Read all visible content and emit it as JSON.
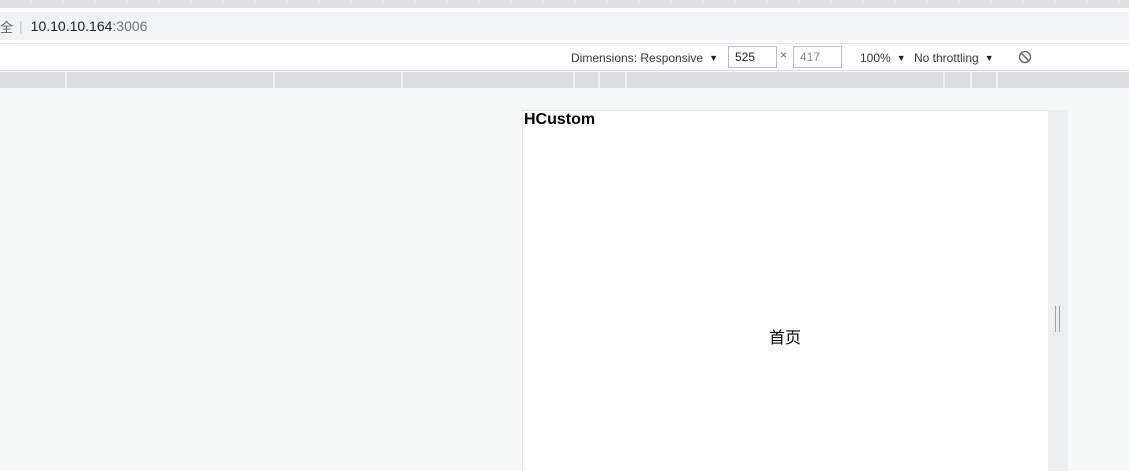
{
  "browser": {
    "security_label": "全",
    "url_host": "10.10.10.164",
    "url_port": ":3006"
  },
  "device_toolbar": {
    "dimensions_label": "Dimensions: Responsive",
    "width_value": "525",
    "height_placeholder": "417",
    "times_sign": "×",
    "zoom": "100%",
    "throttling": "No throttling",
    "dropdown_arrow": "▼",
    "rotate_icon": "rotate-icon"
  },
  "page": {
    "brand": "HCustom",
    "home_text": "首页"
  },
  "colors": {
    "toolbar_bg": "#ffffff",
    "ruler_bg": "#dbdde0",
    "viewport_bg": "#f7f8f8"
  }
}
